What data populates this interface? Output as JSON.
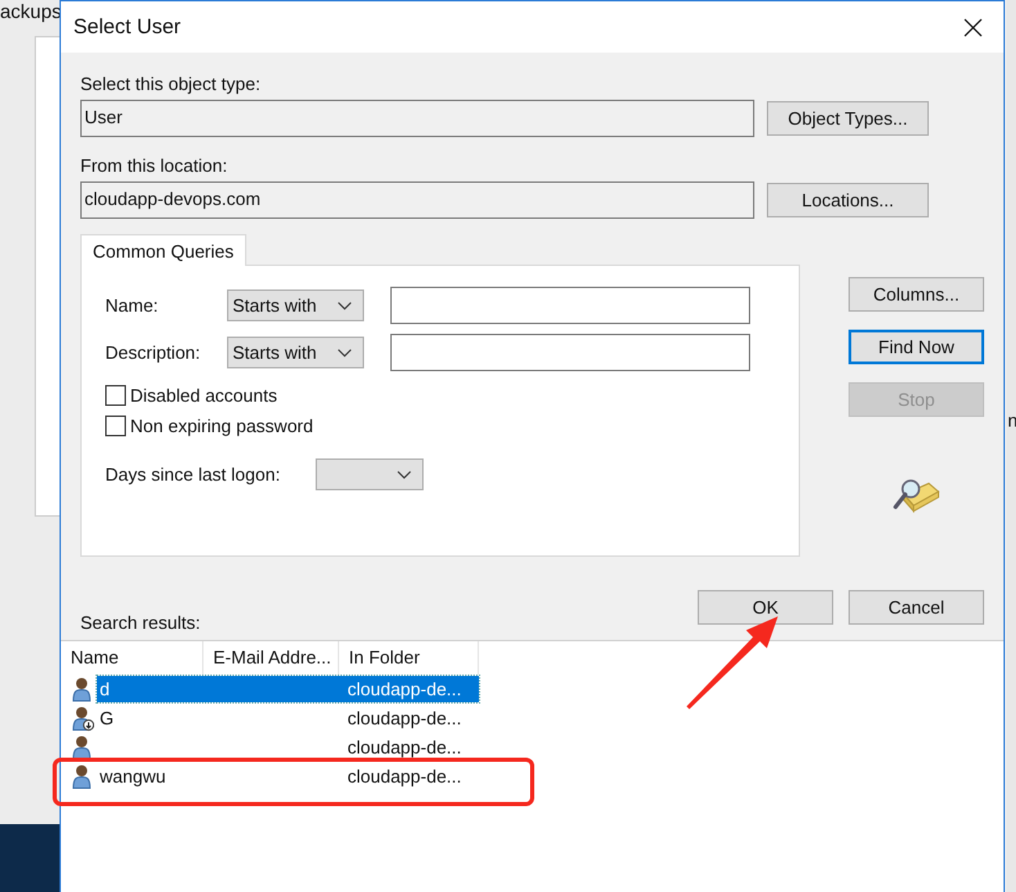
{
  "background": {
    "title": "ackups",
    "side_text": "n"
  },
  "dialog": {
    "title": "Select User",
    "object_type": {
      "label": "Select this object type:",
      "value": "User",
      "button": "Object Types..."
    },
    "location": {
      "label": "From this location:",
      "value": "cloudapp-devops.com",
      "button": "Locations..."
    },
    "tabs": [
      {
        "label": "Common Queries",
        "selected": true
      }
    ],
    "queries": {
      "rows": [
        {
          "label": "Name:",
          "condition": "Starts with"
        },
        {
          "label": "Description:",
          "condition": "Starts with"
        }
      ],
      "checkboxes": [
        {
          "label": "Disabled accounts",
          "checked": false
        },
        {
          "label": "Non expiring password",
          "checked": false
        }
      ],
      "days": {
        "label": "Days since last logon:"
      }
    },
    "side_buttons": [
      {
        "label": "Columns...",
        "focused": false,
        "disabled": false
      },
      {
        "label": "Find Now",
        "focused": true,
        "disabled": false
      },
      {
        "label": "Stop",
        "focused": false,
        "disabled": true
      }
    ],
    "search_results_label": "Search results:",
    "buttons": [
      "OK",
      "Cancel"
    ],
    "results": {
      "columns": [
        "Name",
        "E-Mail Addre...",
        "In Folder"
      ],
      "rows": [
        {
          "kind": "user",
          "name": "d",
          "folder": "cloudapp-de...",
          "selected": true
        },
        {
          "kind": "user-badge",
          "name": "G",
          "folder": "cloudapp-de...",
          "selected": false
        },
        {
          "kind": "user",
          "folder": "cloudapp-de...",
          "selected": false
        },
        {
          "kind": "user",
          "name": "wangwu",
          "folder": "cloudapp-de...",
          "selected": false
        }
      ]
    }
  }
}
